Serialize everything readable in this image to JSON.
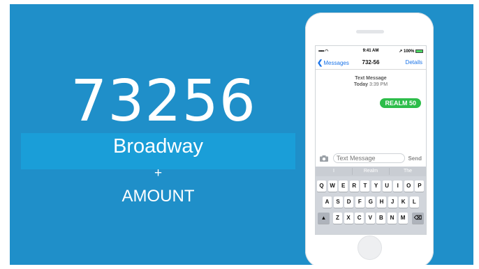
{
  "slide": {
    "code": "73256",
    "keyword": "Broadway",
    "plus": "+",
    "amount": "AMOUNT"
  },
  "phone": {
    "status": {
      "signal": "••••• ◠",
      "time": "9:41 AM",
      "battery": "↗ 100%"
    },
    "nav": {
      "back": "Messages",
      "title": "732-56",
      "details": "Details"
    },
    "thread": {
      "label": "Text Message",
      "day": "Today",
      "time": "3:39 PM"
    },
    "message": "REALM 50",
    "input": {
      "placeholder": "Text Message",
      "send": "Send"
    },
    "suggestions": [
      "I",
      "Realm",
      "The"
    ],
    "keys": {
      "row1": [
        "Q",
        "W",
        "E",
        "R",
        "T",
        "Y",
        "U",
        "I",
        "O",
        "P"
      ],
      "row2": [
        "A",
        "S",
        "D",
        "F",
        "G",
        "H",
        "J",
        "K",
        "L"
      ],
      "row3": [
        "Z",
        "X",
        "C",
        "V",
        "B",
        "N",
        "M"
      ]
    }
  },
  "colors": {
    "background": "#1f8fc9",
    "band": "#1a9ed8",
    "bubble": "#2dbd4a",
    "link": "#1a73e8"
  }
}
